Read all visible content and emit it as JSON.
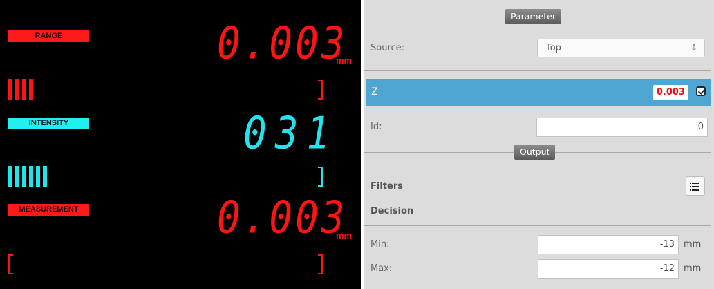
{
  "display": {
    "range": {
      "label": "RANGE",
      "value": "0.003",
      "unit": "mm",
      "bars": 4
    },
    "intensity": {
      "label": "INTENSITY",
      "value": "031",
      "bars": 6
    },
    "measurement": {
      "label": "MEASUREMENT",
      "value": "0.003",
      "unit": "mm"
    },
    "colors": {
      "red": "#ff1414",
      "cyan": "#1fe6ee",
      "background": "#000000"
    }
  },
  "panel": {
    "parameter_title": "Parameter",
    "source": {
      "label": "Source:",
      "value": "Top"
    },
    "z": {
      "label": "Z",
      "value": "0.003",
      "checked": true
    },
    "id": {
      "label": "Id:",
      "value": "0"
    },
    "output_title": "Output",
    "filters_label": "Filters",
    "decision_label": "Decision",
    "min": {
      "label": "Min:",
      "value": "-13",
      "unit": "mm"
    },
    "max": {
      "label": "Max:",
      "value": "-12",
      "unit": "mm"
    },
    "colors": {
      "highlight": "#4fa6d3",
      "panel_bg": "#dcdcdc",
      "value_red": "#ee1111"
    }
  }
}
